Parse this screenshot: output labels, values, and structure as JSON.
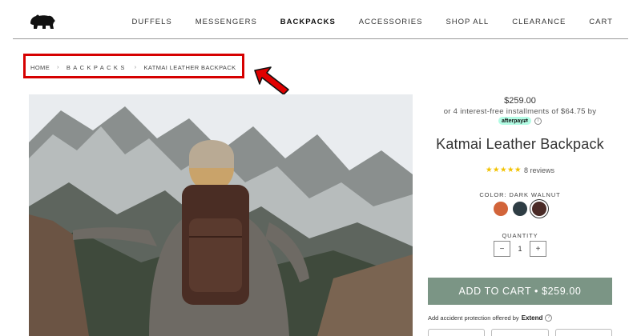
{
  "header": {
    "logo_icon": "bear-logo-icon",
    "nav": [
      {
        "label": "DUFFELS"
      },
      {
        "label": "MESSENGERS"
      },
      {
        "label": "BACKPACKS"
      },
      {
        "label": "ACCESSORIES"
      },
      {
        "label": "SHOP ALL"
      },
      {
        "label": "CLEARANCE"
      },
      {
        "label": "CART"
      }
    ],
    "active_nav": "BACKPACKS"
  },
  "breadcrumb": {
    "home": "HOME",
    "category": "BACKPACKS",
    "current": "KATMAI LEATHER BACKPACK",
    "separator": "›",
    "highlight_color": "#d60000",
    "arrow_icon": "red-arrow-icon"
  },
  "product": {
    "price": "$259.00",
    "installments": "or 4 interest-free installments of $64.75 by",
    "afterpay_label": "afterpay⇄",
    "info_icon": "info-icon",
    "title": "Katmai Leather Backpack",
    "stars": "★★★★★",
    "reviews": "8 reviews",
    "color_label": "COLOR: DARK WALNUT",
    "swatches": [
      {
        "name": "orange",
        "color": "#d2643a"
      },
      {
        "name": "slate",
        "color": "#2e3d44"
      },
      {
        "name": "dark-walnut",
        "color": "#4a2a26",
        "selected": true
      }
    ],
    "quantity_label": "QUANTITY",
    "quantity": "1",
    "qty_minus": "−",
    "qty_plus": "+",
    "add_to_cart": "ADD TO CART • $259.00",
    "add_to_cart_color": "#7b9585",
    "protection_text": "Add accident protection offered by",
    "protection_brand": "Extend",
    "help_icon": "help-circle-icon"
  }
}
